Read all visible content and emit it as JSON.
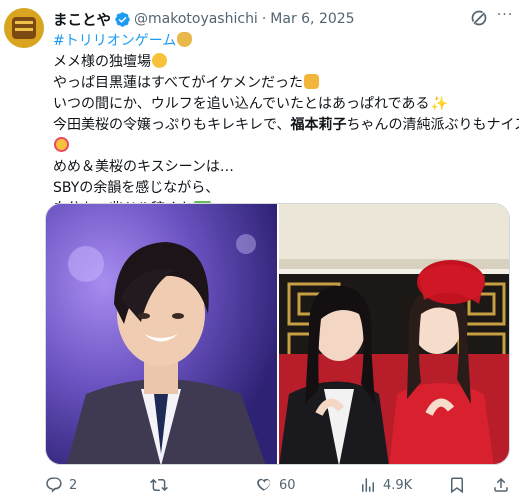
{
  "author": {
    "name": "まことや",
    "handle": "@makotoyashichi",
    "separator": "·",
    "date": "Mar 6, 2025"
  },
  "tweet": {
    "lines": [
      {
        "parts": [
          {
            "text": "#トリリオンゲーム",
            "style": "hashtag"
          }
        ],
        "emoji": "money-bag"
      },
      {
        "parts": [
          {
            "text": "メメ様の独壇場"
          }
        ],
        "emoji": "smile"
      },
      {
        "parts": [
          {
            "text": "やっぱ目黒蓮はすべてがイケメンだった"
          }
        ],
        "emoji": "thumb"
      },
      {
        "parts": [
          {
            "text": "いつの間にか、ウルフを追い込んでいたとはあっぱれである"
          }
        ],
        "emoji": "sparkle"
      },
      {
        "parts": [
          {
            "text": "今田美桜の令嬢っぷりもキレキレで、"
          },
          {
            "text": "福本莉子",
            "style": "bold"
          },
          {
            "text": "ちゃんの清純派ぶりもナイス"
          }
        ]
      },
      {
        "parts": [],
        "emoji": "heart-face"
      },
      {
        "parts": [
          {
            "text": "めめ＆美桜のキスシーンは…"
          }
        ]
      },
      {
        "parts": [
          {
            "text": "SBYの余韻を感じながら、"
          }
        ]
      },
      {
        "parts": [
          {
            "text": "自分も一兆ドル稼ぐか"
          }
        ],
        "emoji": "dollar"
      }
    ]
  },
  "stats": {
    "replies": "2",
    "reposts": "",
    "likes": "60",
    "views": "4.9K"
  },
  "colors": {
    "accent": "#1d9bf0",
    "text": "#0f1419",
    "muted": "#536471"
  }
}
